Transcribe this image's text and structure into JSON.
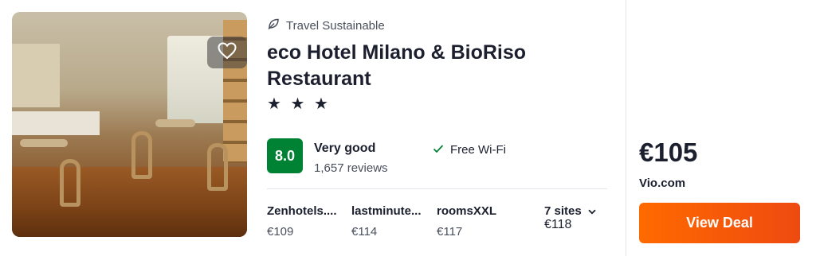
{
  "hotel": {
    "sustainable_label": "Travel Sustainable",
    "name": "eco Hotel Milano & BioRiso Restaurant",
    "stars_text": "★ ★ ★",
    "star_rating": 3,
    "score": "8.0",
    "rating_label": "Very good",
    "reviews": "1,657 reviews",
    "amenity": "Free Wi-Fi"
  },
  "sites": [
    {
      "name": "Zenhotels....",
      "price": "€109"
    },
    {
      "name": "lastminute...",
      "price": "€114"
    },
    {
      "name": "roomsXXL",
      "price": "€117"
    }
  ],
  "more_sites": {
    "label": "7 sites",
    "price": "€118"
  },
  "deal": {
    "price": "€105",
    "provider": "Vio.com",
    "button_label": "View Deal"
  },
  "colors": {
    "score_bg": "#008234",
    "deal_button": "#ff5b00",
    "text": "#1b1f2e"
  },
  "icons": {
    "favorite": "heart-icon",
    "sustainable": "leaf-icon",
    "amenity": "check-icon",
    "expand": "chevron-down-icon"
  }
}
